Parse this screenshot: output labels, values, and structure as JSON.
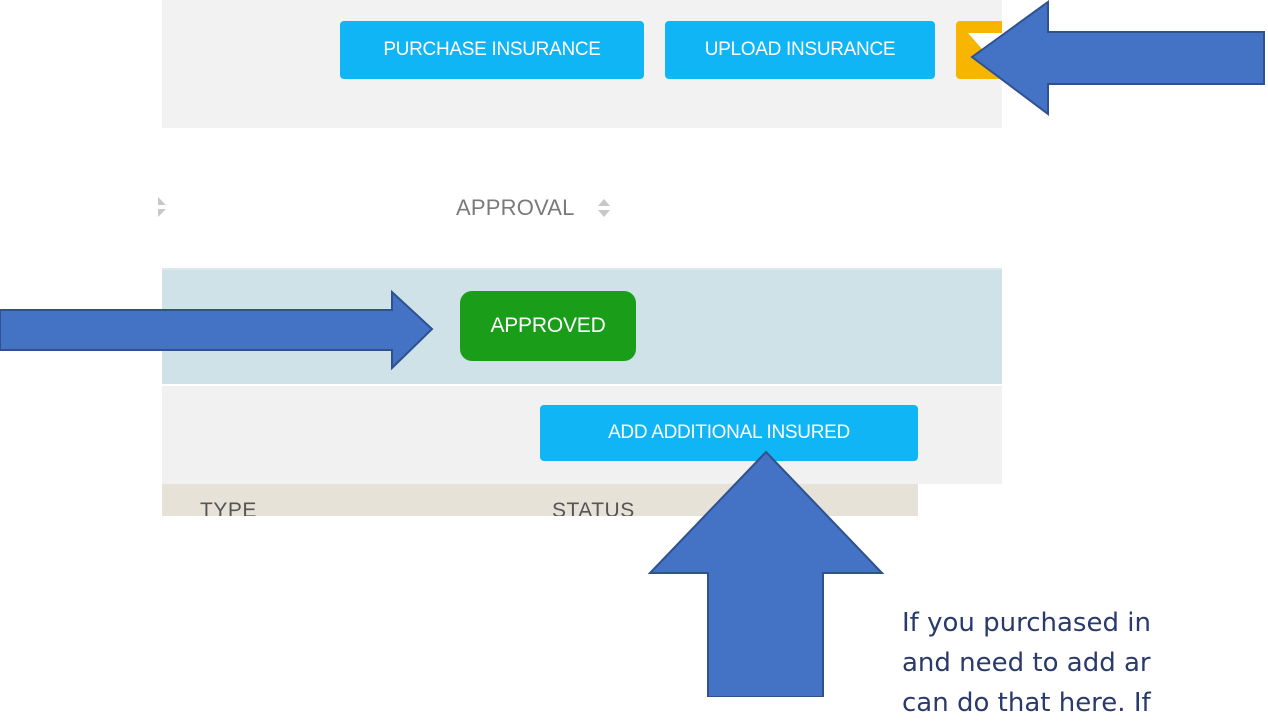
{
  "toolbar": {
    "purchase_label": "PURCHASE INSURANCE",
    "upload_label": "UPLOAD INSURANCE"
  },
  "table": {
    "approval_header": "APPROVAL",
    "row": {
      "approval_status": "APPROVED"
    }
  },
  "insured": {
    "add_label": "ADD ADDITIONAL INSURED",
    "columns": [
      "TYPE",
      "STATUS"
    ]
  },
  "annotation": {
    "lines": [
      "If you purchased in",
      "and need to add ar",
      "can do that here. If"
    ]
  },
  "colors": {
    "button_blue": "#10b5f5",
    "filter_yellow": "#f7b500",
    "approved_green": "#1a9e1a",
    "arrow_blue": "#4472c4"
  },
  "icons": {
    "filter": "funnel-icon",
    "sort": "sort-icon",
    "arrow": "pointer-arrow"
  }
}
